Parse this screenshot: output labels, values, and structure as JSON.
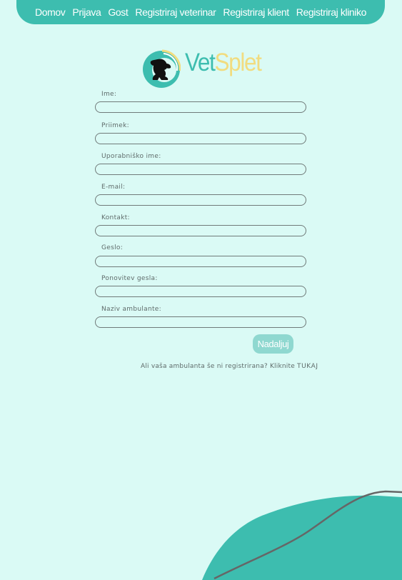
{
  "nav": {
    "items": [
      {
        "label": "Domov"
      },
      {
        "label": "Prijava"
      },
      {
        "label": "Gost"
      },
      {
        "label": "Registriraj veterinar"
      },
      {
        "label": "Registriraj klient"
      },
      {
        "label": "Registriraj kliniko"
      }
    ]
  },
  "logo": {
    "part1": "Vet",
    "part2": "Splet"
  },
  "form": {
    "fields": [
      {
        "label": "Ime:",
        "value": ""
      },
      {
        "label": "Priimek:",
        "value": ""
      },
      {
        "label": "Uporabniško ime:",
        "value": ""
      },
      {
        "label": "E-mail:",
        "value": ""
      },
      {
        "label": "Kontakt:",
        "value": ""
      },
      {
        "label": "Geslo:",
        "value": ""
      },
      {
        "label": "Ponovitev gesla:",
        "value": ""
      },
      {
        "label": "Naziv ambulante:",
        "value": ""
      }
    ],
    "submit_label": "Nadaljuj"
  },
  "footer_note": {
    "text": "Ali vaša ambulanta še ni registrirana? Kliknite",
    "link_label": "TUKAJ"
  },
  "colors": {
    "accent": "#3dbdaf",
    "background": "#dafaf5",
    "logo_yellow": "#f1dc7f",
    "button": "#8fd8d0"
  }
}
